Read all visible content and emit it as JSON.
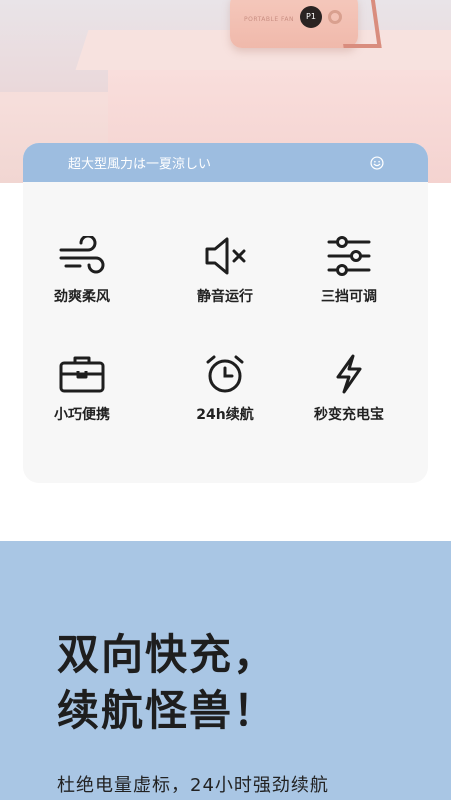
{
  "hero": {
    "fan_label": "PORTABLE FAN",
    "fan_display": "P1"
  },
  "card": {
    "title": "超大型風力は一夏涼しい",
    "features": [
      {
        "icon": "wind-icon",
        "label": "劲爽柔风"
      },
      {
        "icon": "mute-speaker-icon",
        "label": "静音运行"
      },
      {
        "icon": "sliders-icon",
        "label": "三挡可调"
      },
      {
        "icon": "briefcase-icon",
        "label": "小巧便携"
      },
      {
        "icon": "alarm-clock-icon",
        "label": "24h续航"
      },
      {
        "icon": "lightning-icon",
        "label": "秒变充电宝"
      }
    ]
  },
  "promo": {
    "headline_line1": "双向快充，",
    "headline_line2": "续航怪兽！",
    "subtitle": "杜绝电量虚标，24小时强劲续航"
  },
  "colors": {
    "card_header": "#9dbde0",
    "promo_bg": "#a9c6e4",
    "hero_pink": "#f6dedb"
  }
}
